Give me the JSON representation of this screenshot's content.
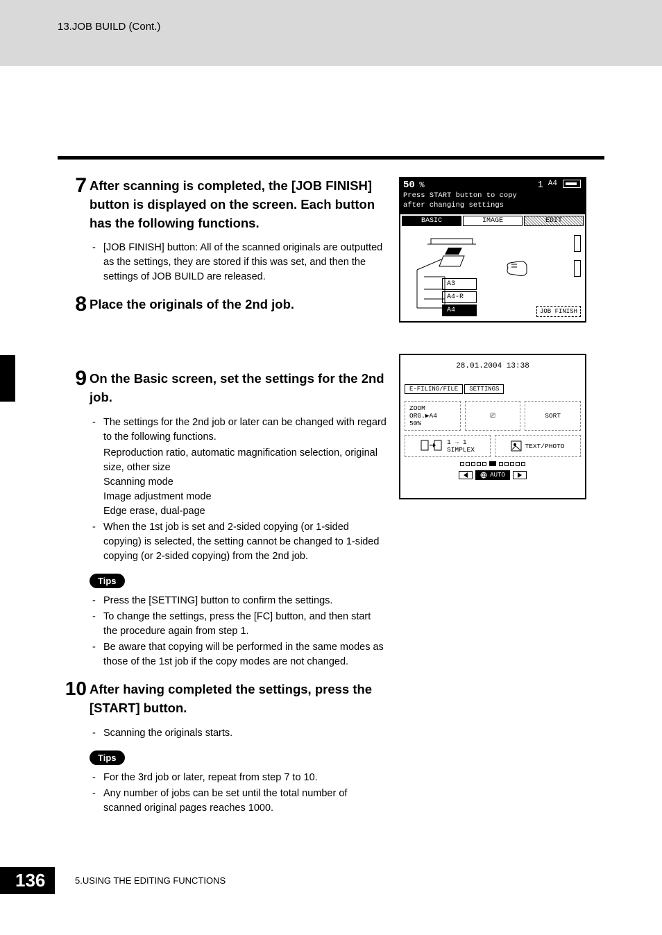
{
  "header": "13.JOB BUILD (Cont.)",
  "steps": {
    "s7": {
      "num": "7",
      "title": "After scanning is completed, the [JOB FINISH] button is displayed on the screen. Each button has the following functions.",
      "bullets": [
        "[JOB FINISH] button: All of the scanned originals are outputted as the settings, they are stored if this was set, and then the settings of JOB BUILD are released."
      ]
    },
    "s8": {
      "num": "8",
      "title": "Place the originals of the 2nd job."
    },
    "s9": {
      "num": "9",
      "title": "On the Basic screen, set the settings for the 2nd job.",
      "bullets1": [
        "The settings for the 2nd job or later can be changed with regard to the following functions."
      ],
      "subs": [
        "Reproduction ratio, automatic magnification selection, original size, other size",
        "Scanning mode",
        "Image adjustment mode",
        "Edge erase, dual-page"
      ],
      "bullets2": [
        "When the 1st job is set and 2-sided copying (or 1-sided copying) is selected, the setting cannot be changed to 1-sided copying (or 2-sided copying) from the 2nd job."
      ],
      "tips_label": "Tips",
      "tips": [
        "Press the [SETTING] button to confirm the settings.",
        "To change the settings, press the [FC] button, and then start the procedure again from step 1.",
        "Be aware that copying will be performed in the same modes as those of the 1st job if the copy modes are not changed."
      ]
    },
    "s10": {
      "num": "10",
      "title": "After having completed the settings, press the [START] button.",
      "bullets": [
        "Scanning the originals starts."
      ],
      "tips_label": "Tips",
      "tips": [
        "For the 3rd job or later, repeat from step 7 to 10.",
        "Any number of jobs can be set until the total number of scanned original pages reaches 1000."
      ]
    }
  },
  "lcd1": {
    "zoom": "50",
    "pct": "%",
    "count": "1",
    "paper": "A4",
    "msg1": "Press START button to copy",
    "msg2": "after changing settings",
    "tabs": {
      "basic": "BASIC",
      "image": "IMAGE",
      "edit": "EDIT"
    },
    "papers": {
      "a3": "A3",
      "a4r": "A4-R",
      "a4": "A4"
    },
    "job_finish": "JOB FINISH"
  },
  "lcd2": {
    "date": "28.01.2004 13:38",
    "tabs": {
      "efiling": "E-FILING/FILE",
      "settings": "SETTINGS"
    },
    "cells": {
      "zoom": "ZOOM  ORG.▶A4\n50%",
      "finisher": "⎚",
      "sort": "SORT",
      "simplex": "1 → 1\nSIMPLEX",
      "textphoto": "TEXT/PHOTO"
    },
    "auto": "AUTO"
  },
  "footer": {
    "page": "136",
    "chapter": "5.USING THE EDITING FUNCTIONS"
  }
}
